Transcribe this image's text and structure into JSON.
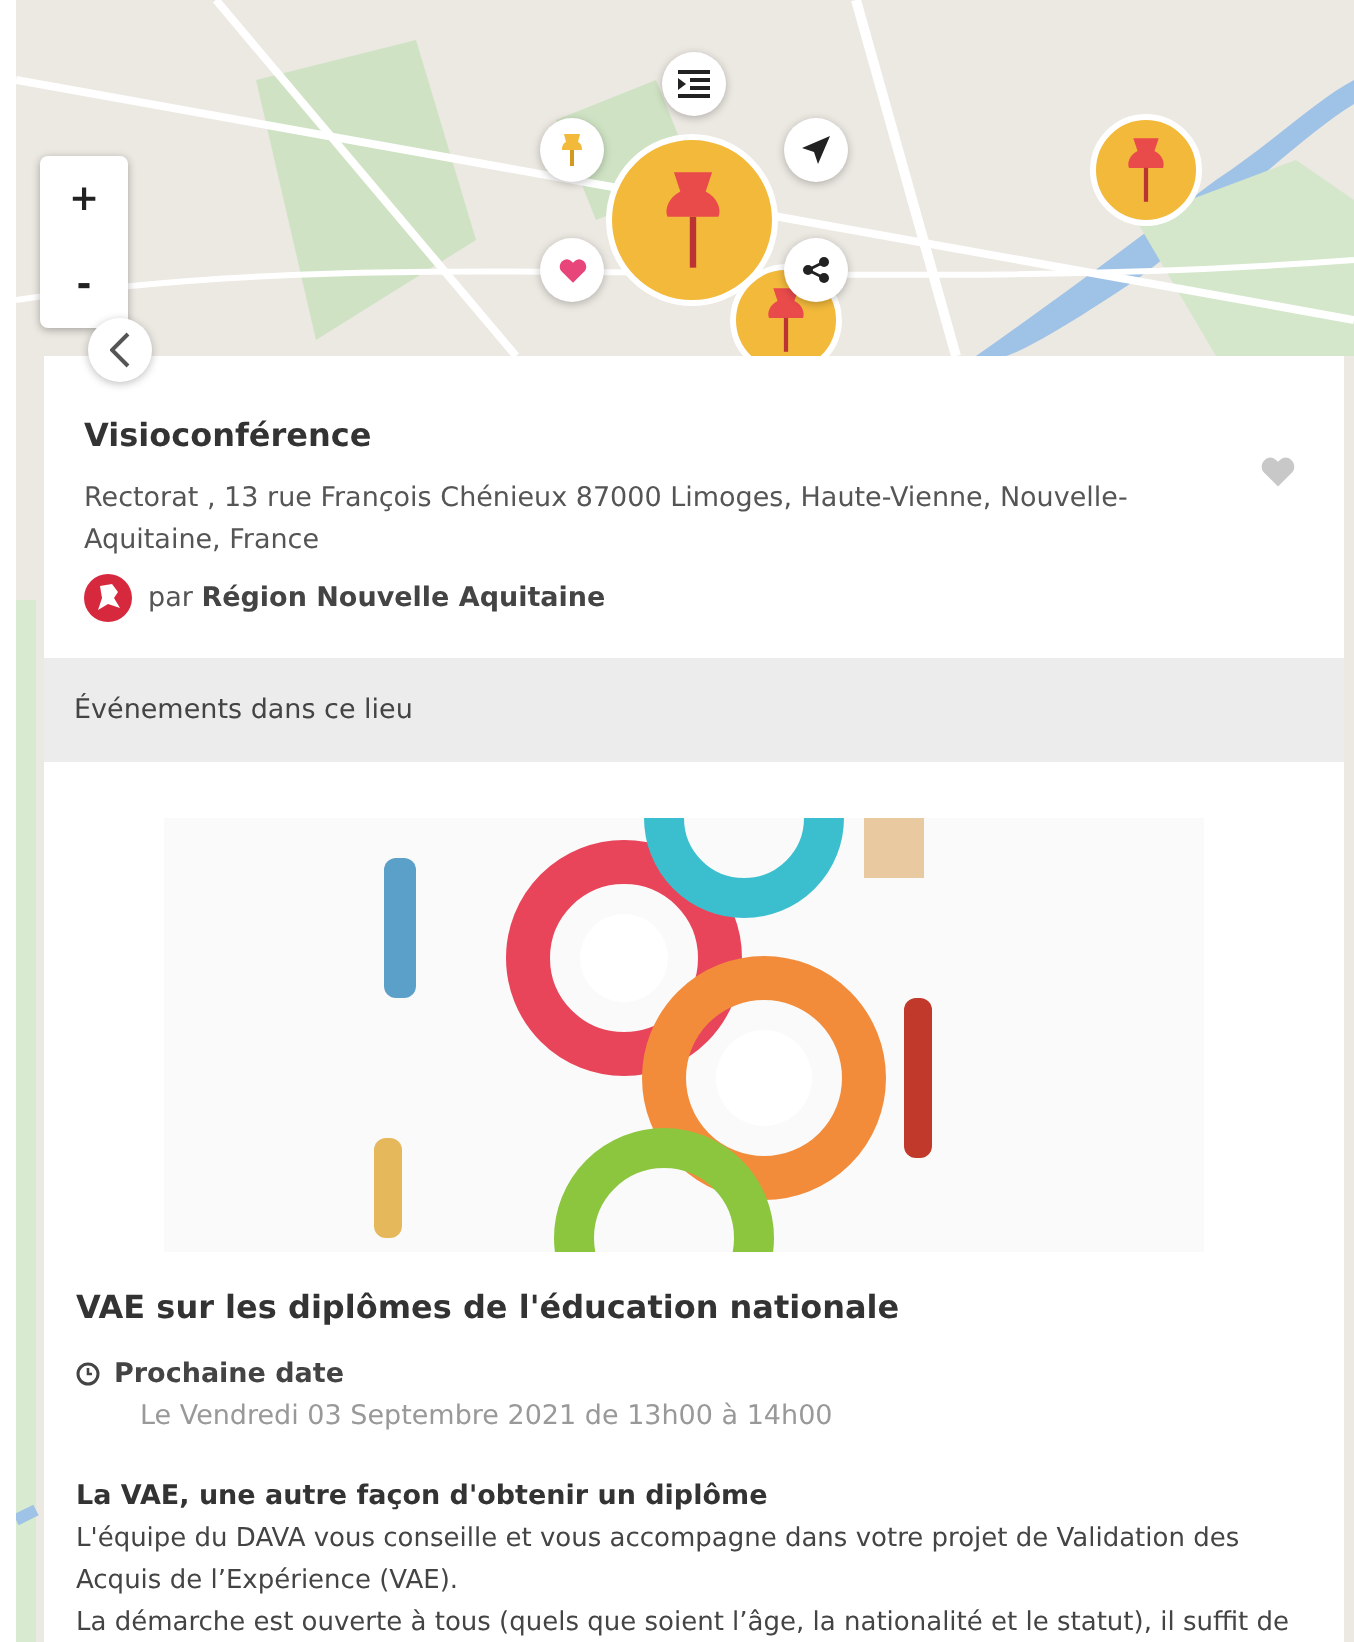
{
  "map": {
    "zoom_in": "+",
    "zoom_out": "-"
  },
  "place": {
    "title": "Visioconférence",
    "address": "Rectorat , 13 rue François Chénieux 87000 Limoges, Haute-Vienne, Nouvelle-Aquitaine, France",
    "by_prefix": "par",
    "by_name": "Région Nouvelle Aquitaine",
    "favorite": false
  },
  "events_header": "Événements dans ce lieu",
  "event": {
    "title": "VAE sur les diplômes de l'éducation nationale",
    "date_label": "Prochaine date",
    "date": "Le Vendredi 03 Septembre 2021 de 13h00 à 14h00",
    "heading": "La VAE, une autre façon d'obtenir un diplôme",
    "paragraphs": [
      "L'équipe du DAVA vous conseille et vous accompagne dans votre projet de Validation des Acquis de l’Expérience (VAE).",
      "La démarche est ouverte à tous (quels que soient l’âge, la nationalité et le statut), il suffit de"
    ]
  }
}
